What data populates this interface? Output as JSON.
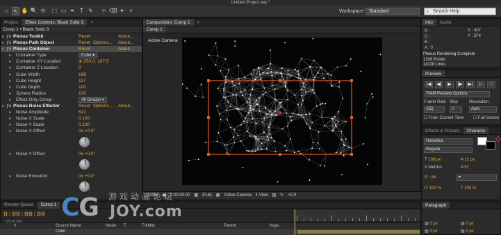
{
  "window": {
    "title": "Untitled Project.aep *"
  },
  "toolbar": {
    "tools": [
      "⌂",
      "↖",
      "✋",
      "🔍",
      "⟲",
      "⬚",
      "▭",
      "✒",
      "T",
      "✎",
      "⊹",
      "⌫",
      "✦",
      "✧"
    ],
    "workspace_label": "Workspace:",
    "workspace_value": "Standard",
    "search_placeholder": "Search Help"
  },
  "effect_controls": {
    "tabs": [
      "Project",
      "Effect Controls: Black Solid 3",
      "×"
    ],
    "header": "Comp 1 • Black Solid 3",
    "rows": [
      {
        "label": "Plexus Toolkit",
        "indent": 8,
        "fx": true,
        "reset": "Reset",
        "about": "About..."
      },
      {
        "label": "Plexus Path Object",
        "indent": 8,
        "fx": true,
        "reset": "Reset",
        "options": "Options...",
        "about": "About..."
      },
      {
        "label": "Plexus Container",
        "indent": 8,
        "fx": true,
        "reset": "Reset",
        "about": "About...",
        "highlight": true
      },
      {
        "label": "Container Type",
        "indent": 18,
        "select": "Cube"
      },
      {
        "label": "Container XY Location",
        "indent": 18,
        "value": "⊕ 250.0, 187.5"
      },
      {
        "label": "Container Z Location",
        "indent": 18,
        "value": "0"
      },
      {
        "label": "Cube Width",
        "indent": 18,
        "value": "168"
      },
      {
        "label": "Cube Height",
        "indent": 18,
        "value": "117"
      },
      {
        "label": "Cube Depth",
        "indent": 18,
        "value": "100"
      },
      {
        "label": "Sphere Radius",
        "indent": 18,
        "value": "100"
      },
      {
        "label": "Effect Only Group",
        "indent": 18,
        "select": "All Groups"
      },
      {
        "label": "Plexus Noise Effector",
        "indent": 8,
        "fx": true,
        "reset": "Reset",
        "options": "Options...",
        "about": "About...",
        "bold": true
      },
      {
        "label": "Noise Amplitude",
        "indent": 18,
        "value": "621"
      },
      {
        "label": "Noise X Scale",
        "indent": 18,
        "value": "0.100"
      },
      {
        "label": "Noise Y Scale",
        "indent": 18,
        "value": "0.100"
      },
      {
        "label": "Noise X Offset",
        "indent": 18,
        "value": "0x +0.0°",
        "knob": true
      },
      {
        "label": "Noise Y Offset",
        "indent": 18,
        "value": "0x +0.0°",
        "knob": true
      },
      {
        "label": "Noise Evolution",
        "indent": 18,
        "value": "0x +0.0°",
        "knob": true
      }
    ]
  },
  "composition": {
    "tabs": [
      "Composition: Comp 1",
      "×"
    ],
    "sub_tab": "Comp 1",
    "camera_label": "Active Camera",
    "bottom_bar": [
      "100%",
      "▣",
      "0:00:00:00",
      "▩",
      "(Full)",
      "▦",
      "Active Camera",
      "1 View",
      "▧",
      "↻",
      "+0.0"
    ]
  },
  "info": {
    "tabs": [
      "Info",
      "Audio"
    ],
    "rgba": [
      "R :",
      "G :",
      "B :",
      "A : 0"
    ],
    "x": "X : 407",
    "y": "Y : 374",
    "status": [
      "Plexus Rendering Complete",
      "1326 Points",
      "11028 Lines"
    ]
  },
  "preview": {
    "tab": "Preview",
    "controls": [
      "|◀",
      "◀|",
      "▶",
      "|▶",
      "▶|",
      "▷",
      "□"
    ],
    "ram_option": "RAM Preview Options",
    "labels": [
      "Frame Rate",
      "Skip",
      "Resolution"
    ],
    "values": [
      "(25)",
      "0",
      "Auto"
    ],
    "checks": [
      "From Current Time",
      "Full Screen"
    ]
  },
  "character": {
    "tabs": [
      "Effects & Presets",
      "Characte"
    ],
    "font": "Helvetica",
    "style": "Regular",
    "size": "108 px",
    "leading": "12 px",
    "tracking": "Metrics",
    "kerning": "57",
    "stroke": "– px",
    "stroke_mode": "▾",
    "vscale": "100 %",
    "hscale": "100 %"
  },
  "paragraph": {
    "tab": "Paragraph",
    "vals": [
      "0 px",
      "0 px",
      "0 px",
      "0 px"
    ]
  },
  "timeline": {
    "tabs": [
      "Render Queue",
      "Comp 1"
    ],
    "timecode": "0:00:00:00",
    "fps": "(25.00 fps)",
    "columns": [
      "#",
      "Source Name",
      "Mode",
      "T",
      "TrkMat",
      "Parent",
      "Keys"
    ],
    "layer_name": "Color"
  },
  "watermark": {
    "big": "CG",
    "cn": "游戏动画论坛",
    "small": "JOY.com"
  },
  "colors": {
    "accent": "#e4a63d",
    "panel": "#2b2b2b",
    "selection": "#e05a28"
  }
}
